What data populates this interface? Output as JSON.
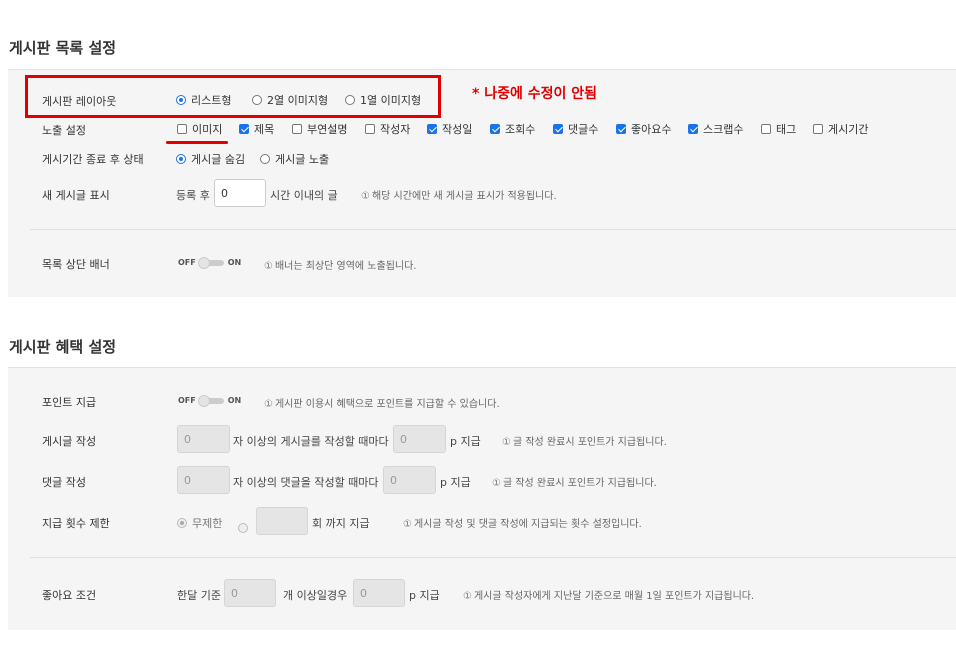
{
  "list_settings": {
    "title": "게시판 목록 설정",
    "layout": {
      "label": "게시판 레이아웃",
      "options": [
        "리스트형",
        "2열 이미지형",
        "1열 이미지형"
      ],
      "selected": "리스트형",
      "annotation": "* 나중에 수정이 안됨"
    },
    "exposure": {
      "label": "노출 설정",
      "items": [
        {
          "label": "이미지",
          "checked": false
        },
        {
          "label": "제목",
          "checked": true
        },
        {
          "label": "부연설명",
          "checked": false
        },
        {
          "label": "작성자",
          "checked": false
        },
        {
          "label": "작성일",
          "checked": true
        },
        {
          "label": "조회수",
          "checked": true
        },
        {
          "label": "댓글수",
          "checked": true
        },
        {
          "label": "좋아요수",
          "checked": true
        },
        {
          "label": "스크랩수",
          "checked": true
        },
        {
          "label": "태그",
          "checked": false
        },
        {
          "label": "게시기간",
          "checked": false
        }
      ]
    },
    "after_period": {
      "label": "게시기간 종료 후 상태",
      "options": [
        "게시글 숨김",
        "게시글 노출"
      ],
      "selected": "게시글 숨김"
    },
    "new_post": {
      "label": "새 게시글 표시",
      "prefix": "등록 후",
      "value": "0",
      "suffix": "시간 이내의 글",
      "hint": "해당 시간에만 새 게시글 표시가 적용됩니다."
    },
    "banner": {
      "label": "목록 상단 배너",
      "off": "OFF",
      "on": "ON",
      "hint": "배너는 최상단 영역에 노출됩니다."
    }
  },
  "benefit_settings": {
    "title": "게시판 혜택 설정",
    "point": {
      "label": "포인트 지급",
      "off": "OFF",
      "on": "ON",
      "hint": "게시판 이용시 혜택으로 포인트를 지급할 수 있습니다."
    },
    "post_write": {
      "label": "게시글 작성",
      "value1": "0",
      "mid": "자 이상의 게시글를 작성할 때마다",
      "value2": "0",
      "unit": "p 지급",
      "hint": "글 작성 완료시 포인트가 지급됩니다."
    },
    "comment_write": {
      "label": "댓글 작성",
      "value1": "0",
      "mid": "자 이상의 댓글을 작성할 때마다",
      "value2": "0",
      "unit": "p 지급",
      "hint": "글 작성 완료시 포인트가 지급됩니다."
    },
    "limit": {
      "label": "지급 횟수 제한",
      "option": "무제한",
      "value": "",
      "suffix": "회 까지 지급",
      "hint": "게시글 작성 및 댓글 작성에 지급되는 횟수 설정입니다."
    },
    "like": {
      "label": "좋아요 조건",
      "prefix": "한달 기준",
      "value1": "0",
      "mid": "개 이상일경우",
      "value2": "0",
      "unit": "p 지급",
      "hint": "게시글 작성자에게 지난달 기준으로 매월 1일 포인트가 지급됩니다."
    }
  },
  "info_icon": "①",
  "colors": {
    "accent": "#1a73e8",
    "highlight_red": "#e00000"
  }
}
